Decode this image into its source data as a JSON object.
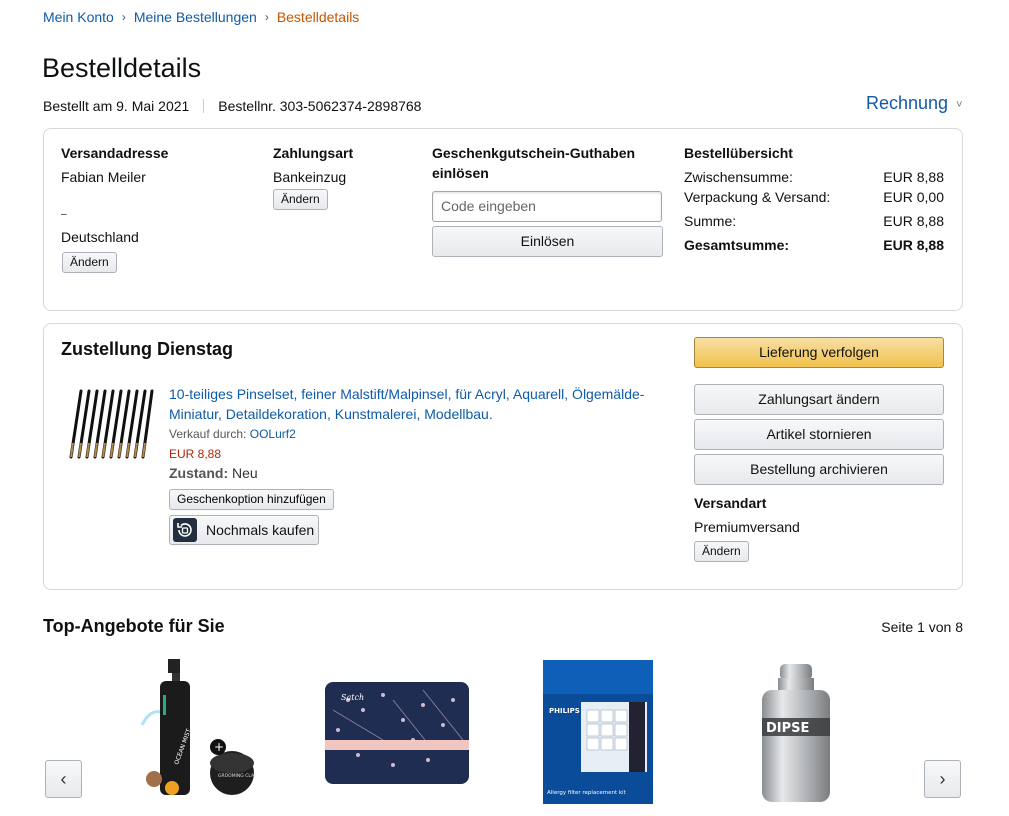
{
  "breadcrumb": {
    "account": "Mein Konto",
    "orders": "Meine Bestellungen",
    "current": "Bestelldetails",
    "separator": "›"
  },
  "page_title": "Bestelldetails",
  "order_meta": {
    "ordered_on": "Bestellt am 9. Mai 2021",
    "order_number": "Bestellnr. 303-5062374-2898768"
  },
  "invoice": {
    "label": "Rechnung",
    "chevron": "˅"
  },
  "shipping_address": {
    "heading": "Versandadresse",
    "name": "Fabian Meiler",
    "line2": "–",
    "country": "Deutschland",
    "change": "Ändern"
  },
  "payment": {
    "heading": "Zahlungsart",
    "method": "Bankeinzug",
    "change": "Ändern"
  },
  "gift_card": {
    "heading_line1": "Geschenkgutschein-Guthaben",
    "heading_line2": "einlösen",
    "placeholder": "Code eingeben",
    "redeem": "Einlösen"
  },
  "summary": {
    "heading": "Bestellübersicht",
    "rows": [
      {
        "label": "Zwischensumme:",
        "value": "EUR 8,88"
      },
      {
        "label": "Verpackung & Versand:",
        "value": "EUR 0,00"
      },
      {
        "label": "Summe:",
        "value": "EUR 8,88"
      },
      {
        "label": "Gesamtsumme:",
        "value": "EUR 8,88"
      }
    ]
  },
  "delivery": {
    "heading": "Zustellung Dienstag",
    "product_title": "10-teiliges Pinselset, feiner Malstift/Malpinsel, für Acryl, Aquarell, Ölgemälde-Miniatur, Detaildekoration, Kunstmalerei, Modellbau.",
    "sold_by_label": "Verkauf durch:",
    "seller": "OOLurf2",
    "price": "EUR 8,88",
    "condition_label": "Zustand:",
    "condition": "Neu",
    "gift_option": "Geschenkoption hinzufügen",
    "buy_again": "Nochmals kaufen"
  },
  "actions": {
    "track": "Lieferung verfolgen",
    "change_payment": "Zahlungsart ändern",
    "cancel": "Artikel stornieren",
    "archive": "Bestellung archivieren"
  },
  "shipping_method": {
    "heading": "Versandart",
    "value": "Premiumversand",
    "change": "Ändern"
  },
  "recommendations": {
    "heading": "Top-Angebote für Sie",
    "page_indicator": "Seite 1 von 8",
    "prev": "‹",
    "next": "›",
    "products": [
      {
        "text1": "OCEAN MIST",
        "text2": "GROOMING CLAY"
      },
      {
        "text1": "Satch"
      },
      {
        "text1": "PHILIPS",
        "text2": "Allergy filter replacement kit"
      },
      {
        "text1": "DIPSE"
      }
    ]
  },
  "colors": {
    "link": "#0f5ba8",
    "breadcrumb_current": "#c45500",
    "price": "#b12704",
    "track_button": "#f0c14b"
  }
}
